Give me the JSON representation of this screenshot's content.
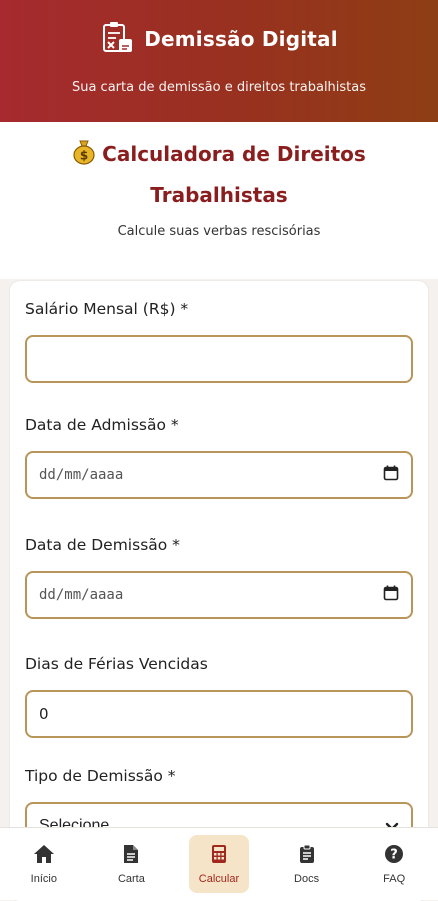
{
  "header": {
    "title": "Demissão Digital",
    "subtitle": "Sua carta de demissão e direitos trabalhistas"
  },
  "intro": {
    "title": "Calculadora de Direitos Trabalhistas",
    "subtitle": "Calcule suas verbas rescisórias"
  },
  "form": {
    "salary": {
      "label": "Salário Mensal (R$) *",
      "value": ""
    },
    "admission": {
      "label": "Data de Admissão *",
      "placeholder": "dd/mm/aaaa"
    },
    "dismissal": {
      "label": "Data de Demissão *",
      "placeholder": "dd/mm/aaaa"
    },
    "vacation": {
      "label": "Dias de Férias Vencidas",
      "value": "0"
    },
    "type": {
      "label": "Tipo de Demissão *",
      "selected": "Selecione"
    }
  },
  "nav": {
    "items": [
      {
        "label": "Início",
        "icon": "home-icon"
      },
      {
        "label": "Carta",
        "icon": "document-icon"
      },
      {
        "label": "Calcular",
        "icon": "calculator-icon",
        "active": true
      },
      {
        "label": "Docs",
        "icon": "clipboard-icon"
      },
      {
        "label": "FAQ",
        "icon": "question-icon"
      }
    ]
  },
  "colors": {
    "header_start": "#a62a2f",
    "header_end": "#8e3e14",
    "accent_title": "#8a1d1d",
    "field_border": "#b8965a",
    "nav_active_bg": "#f6e4c9",
    "nav_active_text": "#a0281e"
  }
}
